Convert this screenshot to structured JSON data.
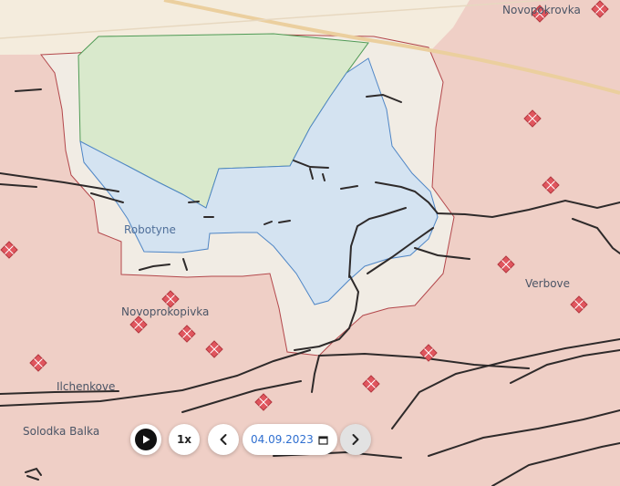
{
  "map": {
    "places": [
      {
        "id": "novopokrovka",
        "name": "Novopokrovka"
      },
      {
        "id": "robotyne",
        "name": "Robotyne"
      },
      {
        "id": "novoprokopivka",
        "name": "Novoprokopivka"
      },
      {
        "id": "verbove",
        "name": "Verbove"
      },
      {
        "id": "ilchenkove",
        "name": "Ilchenkove"
      },
      {
        "id": "solodka_balka",
        "name": "Solodka Balka"
      }
    ],
    "colors": {
      "occupied": "#efcfc6",
      "occupied_border": "#b3474b",
      "contested": "#f1ece4",
      "liberated_recent": "#d4e3f1",
      "liberated_recent_border": "#4f86c6",
      "ukraine_controlled": "#d9e9cc",
      "ukraine_border": "#4f9a55",
      "road": "#ebcf9e",
      "fortification": "#2e2a2a",
      "marker": "#e0565e"
    },
    "legend_icons": [
      "fortification-line",
      "diamond-marker"
    ]
  },
  "timeline": {
    "play_icon": "play-icon",
    "speed_label": "1x",
    "prev_icon": "chevron-left-icon",
    "date": "04.09.2023",
    "calendar_icon": "calendar-icon",
    "next_icon": "chevron-right-icon"
  }
}
